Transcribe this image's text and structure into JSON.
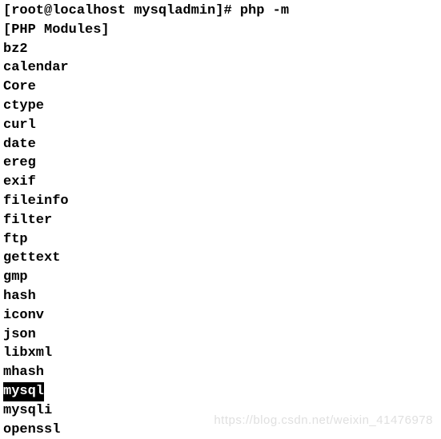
{
  "terminal": {
    "prompt": "[root@localhost mysqladmin]# ",
    "command": "php -m",
    "header": "[PHP Modules]",
    "modules": [
      "bz2",
      "calendar",
      "Core",
      "ctype",
      "curl",
      "date",
      "ereg",
      "exif",
      "fileinfo",
      "filter",
      "ftp",
      "gettext",
      "gmp",
      "hash",
      "iconv",
      "json",
      "libxml",
      "mhash",
      "mysql",
      "mysqli",
      "openssl"
    ],
    "highlighted_module": "mysql"
  },
  "watermark": "https://blog.csdn.net/weixin_41476978"
}
